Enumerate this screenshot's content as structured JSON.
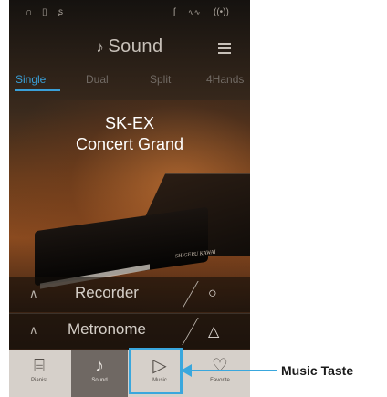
{
  "statusbar": {
    "headphone_icon": "headphone-icon",
    "usb_icon": "usb-icon",
    "bluetooth_icon": "bluetooth-icon",
    "midi_icon": "midi-icon",
    "wlan_icon": "wlan-icon"
  },
  "header": {
    "title": "Sound",
    "menu_icon": "menu-icon"
  },
  "tabs": [
    {
      "label": "Single",
      "active": true
    },
    {
      "label": "Dual",
      "active": false
    },
    {
      "label": "Split",
      "active": false
    },
    {
      "label": "4Hands",
      "active": false
    }
  ],
  "sound": {
    "line1": "SK-EX",
    "line2": "Concert Grand"
  },
  "piano_logo": "SHIGERU KAWAI",
  "panels": [
    {
      "label": "Recorder",
      "icon": "record-icon"
    },
    {
      "label": "Metronome",
      "icon": "metronome-icon"
    }
  ],
  "navbar": [
    {
      "label": "Pianist",
      "icon": "piano-icon",
      "active": false
    },
    {
      "label": "Sound",
      "icon": "music-note-icon",
      "active": true
    },
    {
      "label": "Music",
      "icon": "play-icon",
      "active": false
    },
    {
      "label": "Favorite",
      "icon": "heart-icon",
      "active": false
    }
  ],
  "callout": {
    "text": "Music Taste"
  },
  "colors": {
    "accent": "#3aa7dd",
    "tab_active": "#3aa0d8",
    "nav_bg": "#d6d0ca"
  }
}
